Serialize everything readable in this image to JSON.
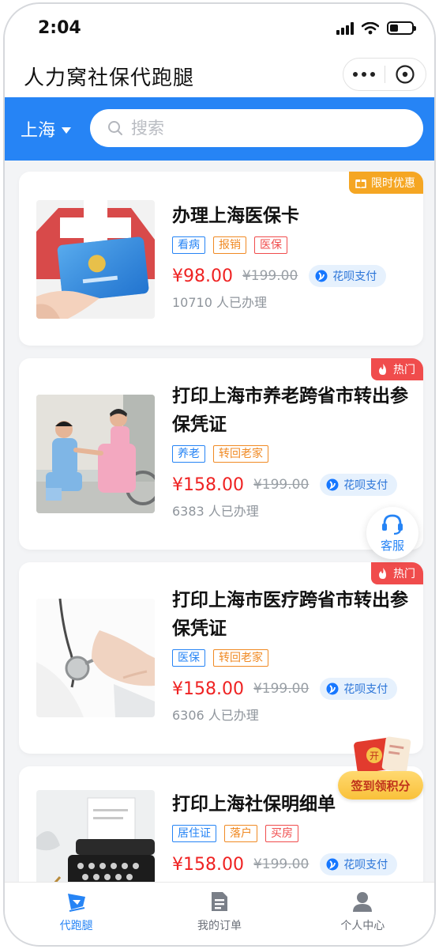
{
  "status_bar": {
    "time": "2:04"
  },
  "nav": {
    "title": "人力窝社保代跑腿"
  },
  "search": {
    "city": "上海",
    "placeholder": "搜索"
  },
  "products": [
    {
      "badge": "限时优惠",
      "badge_type": "offer",
      "title": "办理上海医保卡",
      "tags": [
        {
          "text": "看病",
          "color": "blue"
        },
        {
          "text": "报销",
          "color": "orange"
        },
        {
          "text": "医保",
          "color": "red"
        }
      ],
      "price": "¥98.00",
      "old_price": "¥199.00",
      "pay_label": "花呗支付",
      "sold": "10710 人已办理"
    },
    {
      "badge": "热门",
      "badge_type": "hot",
      "title": "打印上海市养老跨省市转出参保凭证",
      "tags": [
        {
          "text": "养老",
          "color": "blue"
        },
        {
          "text": "转回老家",
          "color": "orange"
        }
      ],
      "price": "¥158.00",
      "old_price": "¥199.00",
      "pay_label": "花呗支付",
      "sold": "6383 人已办理"
    },
    {
      "badge": "热门",
      "badge_type": "hot",
      "title": "打印上海市医疗跨省市转出参保凭证",
      "tags": [
        {
          "text": "医保",
          "color": "blue"
        },
        {
          "text": "转回老家",
          "color": "orange"
        }
      ],
      "price": "¥158.00",
      "old_price": "¥199.00",
      "pay_label": "花呗支付",
      "sold": "6306 人已办理"
    },
    {
      "badge": "",
      "badge_type": "",
      "title": "打印上海社保明细单",
      "tags": [
        {
          "text": "居住证",
          "color": "blue"
        },
        {
          "text": "落户",
          "color": "orange"
        },
        {
          "text": "买房",
          "color": "red"
        }
      ],
      "price": "¥158.00",
      "old_price": "¥199.00",
      "pay_label": "花呗支付",
      "sold": ""
    }
  ],
  "floating": {
    "customer_service": "客服",
    "signin": "签到领积分",
    "envelope_char": "开"
  },
  "tab_bar": {
    "items": [
      {
        "label": "代跑腿",
        "icon": "flag-icon",
        "active": true
      },
      {
        "label": "我的订单",
        "icon": "document-icon",
        "active": false
      },
      {
        "label": "个人中心",
        "icon": "person-icon",
        "active": false
      }
    ]
  },
  "colors": {
    "brand": "#2684f5",
    "price": "#ef2222",
    "hot": "#f04c4c",
    "offer": "#f5a623"
  }
}
